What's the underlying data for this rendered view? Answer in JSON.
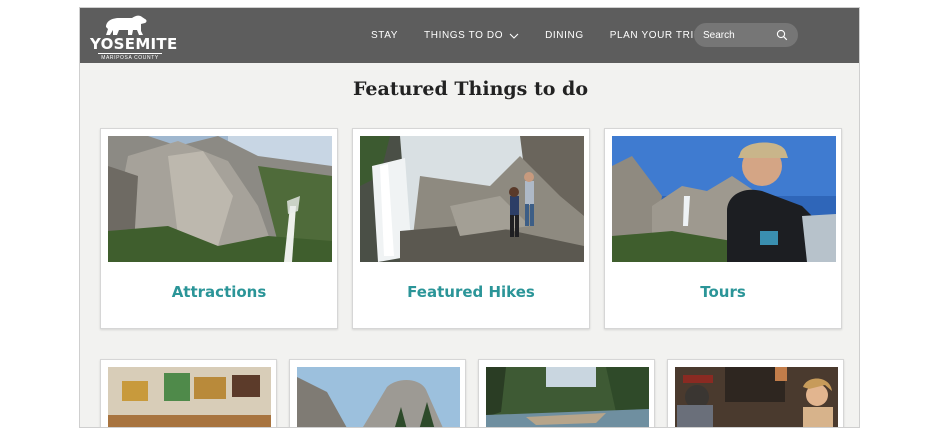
{
  "brand": {
    "name": "YOSEMITE",
    "tagline": "MARIPOSA COUNTY",
    "logo_icon": "bear-icon"
  },
  "nav": {
    "items": [
      {
        "label": "STAY",
        "has_dropdown": false
      },
      {
        "label": "THINGS TO DO",
        "has_dropdown": true
      },
      {
        "label": "DINING",
        "has_dropdown": false
      },
      {
        "label": "PLAN YOUR TRIP",
        "has_dropdown": true
      }
    ]
  },
  "search": {
    "placeholder": "Search",
    "icon": "search-icon"
  },
  "main": {
    "title": "Featured Things to do",
    "featured": [
      {
        "label": "Attractions",
        "image": "waterfall-cliff-photo"
      },
      {
        "label": "Featured Hikes",
        "image": "hikers-waterfall-photo"
      },
      {
        "label": "Tours",
        "image": "tour-guide-valley-photo"
      }
    ],
    "more": [
      {
        "image": "art-gallery-photo"
      },
      {
        "image": "half-dome-photo"
      },
      {
        "image": "river-forest-photo"
      },
      {
        "image": "old-west-photo"
      }
    ]
  },
  "colors": {
    "header_bg": "#5d5d5d",
    "page_bg": "#f2f2f0",
    "accent": "#2b9598",
    "search_bg": "#767676"
  }
}
